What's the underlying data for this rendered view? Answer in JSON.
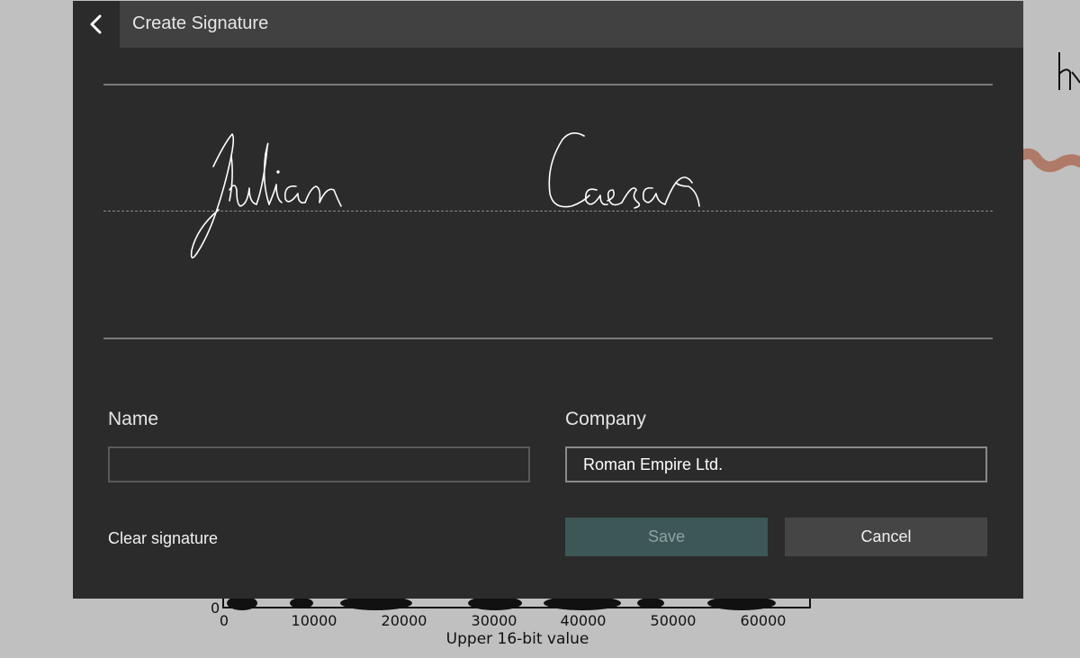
{
  "background_plot": {
    "x_ticks": [
      "0",
      "10000",
      "20000",
      "30000",
      "40000",
      "50000",
      "60000"
    ],
    "y_tick": "0",
    "x_label": "Upper 16-bit value"
  },
  "dialog": {
    "title": "Create Signature",
    "back_icon": "chevron-left-icon",
    "signature_text": "Julian Caesar",
    "name": {
      "label": "Name",
      "value": ""
    },
    "company": {
      "label": "Company",
      "value": "Roman Empire Ltd."
    },
    "clear_label": "Clear signature",
    "save_label": "Save",
    "cancel_label": "Cancel"
  },
  "colors": {
    "dialog_bg": "#2b2b2b",
    "titlebar_bg": "#414141",
    "save_bg": "#3d5656",
    "cancel_bg": "#454545",
    "page_bg": "#c0c0c0"
  }
}
